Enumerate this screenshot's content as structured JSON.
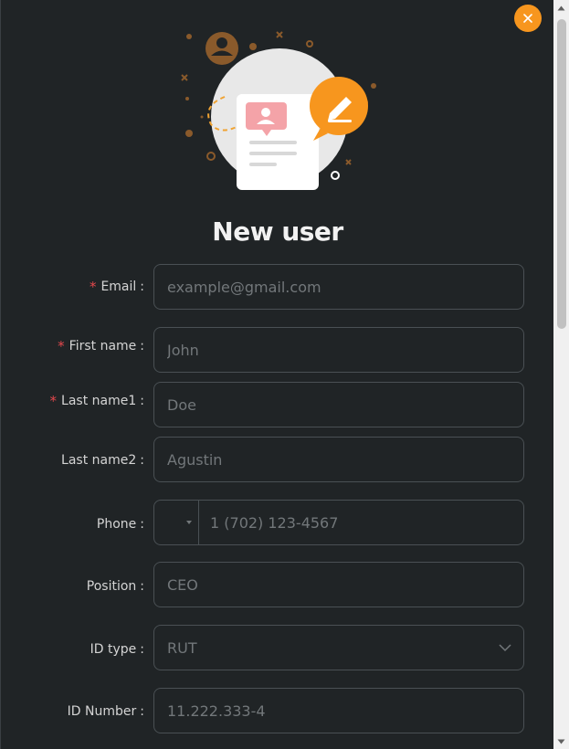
{
  "dialog": {
    "title": "New user"
  },
  "colors": {
    "accent": "#f7961e",
    "required": "#e5484d",
    "background": "#202426"
  },
  "icons": {
    "close": "close-icon",
    "phone_dropdown": "caret-down-icon",
    "select_chevron": "chevron-down-icon"
  },
  "form": {
    "required_marker": "*",
    "colon": ":",
    "email": {
      "label": "Email",
      "placeholder": "example@gmail.com",
      "value": ""
    },
    "first_name": {
      "label": "First name",
      "placeholder": "John",
      "value": ""
    },
    "last_name1": {
      "label": "Last name1",
      "placeholder": "Doe",
      "value": ""
    },
    "last_name2": {
      "label": "Last name2",
      "placeholder": "Agustin",
      "value": ""
    },
    "phone": {
      "label": "Phone",
      "placeholder": "1 (702) 123-4567",
      "value": ""
    },
    "position": {
      "label": "Position",
      "placeholder": "CEO",
      "value": ""
    },
    "id_type": {
      "label": "ID type",
      "selected": "RUT"
    },
    "id_number": {
      "label": "ID Number",
      "placeholder": "11.222.333-4",
      "value": ""
    }
  }
}
